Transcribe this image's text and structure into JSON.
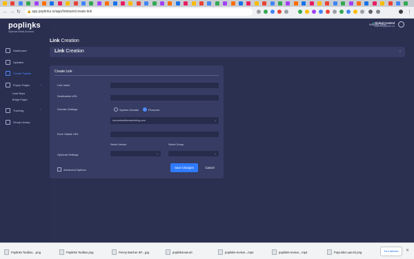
{
  "browser": {
    "url": "app.poplinks.io/app/linkbank/create-link"
  },
  "brand": {
    "logo": "popliŋks",
    "tagline": "Special Meta Access"
  },
  "header": {
    "account_title": "Global Control",
    "account_email": "mathieu@peink.ch",
    "user_name": "Mathieu Janin"
  },
  "sidebar": {
    "items": [
      {
        "label": "Dashboard"
      },
      {
        "label": "Updates"
      },
      {
        "label": "Create Poplink"
      },
      {
        "label": "Popup Pages"
      },
      {
        "label": "Tracking"
      },
      {
        "label": "Group Library"
      }
    ],
    "subitems": [
      {
        "label": "Lead Steps"
      },
      {
        "label": "Bridge Pages"
      }
    ]
  },
  "page": {
    "title_bold": "Link",
    "title_rest": "Creation",
    "section_bold": "Link",
    "section_rest": "Creation"
  },
  "form": {
    "card_title": "Create Link",
    "link_name_label": "Link name",
    "destination_label": "Destination URL",
    "domain_settings_label": "Domain Settings",
    "radio_system": "System Domain",
    "radio_personal": "Personal",
    "domain_value": "succeedwithemarketing.com",
    "error_url_label": "Error Visible URL",
    "select_vendor_label": "Select Vendor",
    "select_group_label": "Select Group",
    "optional_label": "Optional Settings",
    "advanced_label": "Advanced Options",
    "save_label": "Save Changes",
    "cancel_label": "Cancel"
  },
  "downloads": {
    "items": [
      {
        "name": "Poplinks Toolbox....png"
      },
      {
        "name": "Poplinks Toolbox.png"
      },
      {
        "name": "Penny Butcher SP....jpg"
      },
      {
        "name": "poplinksnow.srt"
      },
      {
        "name": "poplinks-review....mp4"
      },
      {
        "name": "poplinks-review....mp4"
      },
      {
        "name": "PopLinks Launch.png"
      }
    ],
    "show_all": "Tout afficher"
  },
  "colors": {
    "accent": "#2f7bff",
    "background": "#2b3051",
    "card": "#363c63"
  }
}
